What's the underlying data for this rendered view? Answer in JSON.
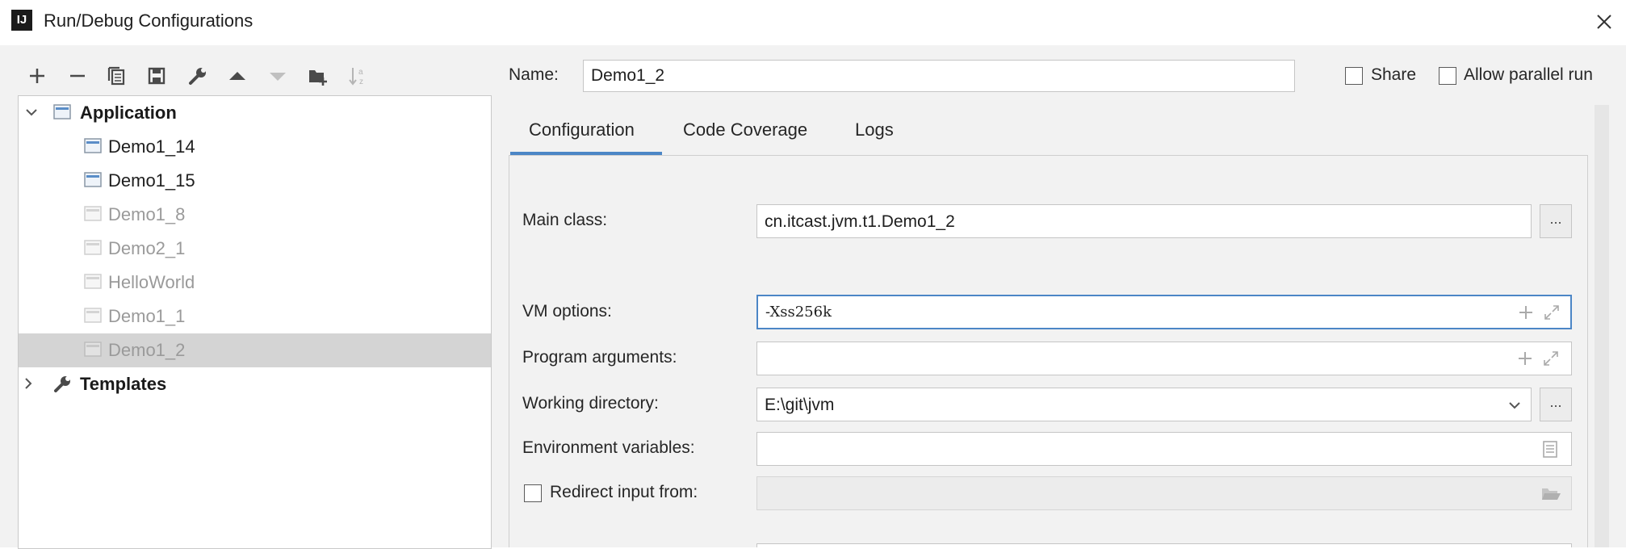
{
  "window": {
    "title": "Run/Debug Configurations",
    "logo_text": "IJ"
  },
  "toolbar": {
    "icons": [
      "add-icon",
      "remove-icon",
      "copy-icon",
      "save-icon",
      "wrench-icon",
      "move-up-icon",
      "move-down-icon",
      "new-folder-icon",
      "sort-icon"
    ]
  },
  "tree": {
    "application": {
      "label": "Application",
      "expanded": true
    },
    "items": [
      {
        "label": "Demo1_14",
        "temporary": false
      },
      {
        "label": "Demo1_15",
        "temporary": false
      },
      {
        "label": "Demo1_8",
        "temporary": true
      },
      {
        "label": "Demo2_1",
        "temporary": true
      },
      {
        "label": "HelloWorld",
        "temporary": true
      },
      {
        "label": "Demo1_1",
        "temporary": true
      },
      {
        "label": "Demo1_2",
        "temporary": true,
        "selected": true
      }
    ],
    "templates": {
      "label": "Templates",
      "expanded": false
    }
  },
  "form": {
    "name_label": "Name:",
    "name_value": "Demo1_2",
    "share_label": "Share",
    "share_checked": false,
    "parallel_label": "Allow parallel run",
    "parallel_checked": false
  },
  "tabs": [
    {
      "label": "Configuration",
      "active": true
    },
    {
      "label": "Code Coverage",
      "active": false
    },
    {
      "label": "Logs",
      "active": false
    }
  ],
  "config": {
    "main_class_label": "Main class:",
    "main_class_value": "cn.itcast.jvm.t1.Demo1_2",
    "vm_options_label": "VM options:",
    "vm_options_value": "-Xss256k",
    "program_args_label": "Program arguments:",
    "program_args_value": "",
    "working_dir_label": "Working directory:",
    "working_dir_value": "E:\\git\\jvm",
    "env_vars_label": "Environment variables:",
    "env_vars_value": "",
    "redirect_label": "Redirect input from:",
    "redirect_checked": false,
    "browse_label": "..."
  },
  "colors": {
    "accent": "#4c86c6",
    "selection": "#d4d4d4",
    "panel": "#f2f2f2"
  }
}
